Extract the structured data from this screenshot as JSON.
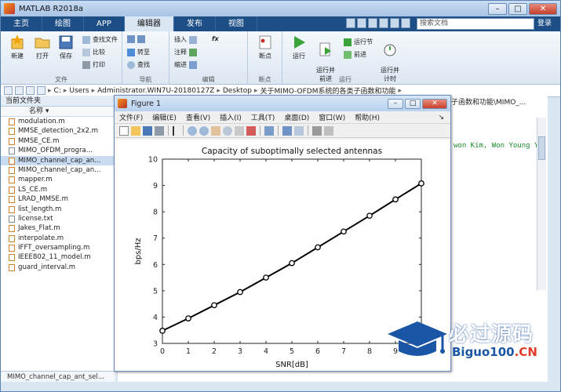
{
  "window": {
    "title": "MATLAB R2018a"
  },
  "tabs": [
    {
      "label": "主页"
    },
    {
      "label": "绘图"
    },
    {
      "label": "APP"
    },
    {
      "label": "编辑器"
    },
    {
      "label": "发布"
    },
    {
      "label": "视图"
    }
  ],
  "search": {
    "placeholder": "搜索文档"
  },
  "login_label": "登录",
  "toolstrip": {
    "file": {
      "label": "文件",
      "new": "新建",
      "open": "打开",
      "save": "保存",
      "find_files": "查找文件",
      "compare": "比较",
      "print": "打印"
    },
    "navigate": {
      "label": "导航",
      "goto": "转至",
      "find": "查找"
    },
    "edit": {
      "label": "编辑",
      "insert": "插入",
      "comment": "注释",
      "indent": "缩进",
      "fx": "fx"
    },
    "breakpoints": {
      "label": "断点",
      "breakpoint": "断点"
    },
    "run": {
      "label": "运行",
      "run": "运行",
      "run_advance": "运行并\n前进",
      "run_section": "运行节",
      "advance": "前进",
      "run_time": "运行并\n计时"
    }
  },
  "path": [
    "C:",
    "Users",
    "Administrator.WIN7U-20180127Z",
    "Desktop",
    "关于MIMO-OFDM系统的各类子函数和功能"
  ],
  "file_panel": {
    "header": "当前文件夹",
    "column": "名称",
    "files": [
      {
        "name": "modulation.m",
        "type": "m"
      },
      {
        "name": "MMSE_detection_2x2.m",
        "type": "m"
      },
      {
        "name": "MMSE_CE.m",
        "type": "m"
      },
      {
        "name": "MIMO_OFDM_progra...",
        "type": "doc"
      },
      {
        "name": "MIMO_channel_cap_an...",
        "type": "m",
        "selected": true
      },
      {
        "name": "MIMO_channel_cap_an...",
        "type": "m"
      },
      {
        "name": "mapper.m",
        "type": "m"
      },
      {
        "name": "LS_CE.m",
        "type": "m"
      },
      {
        "name": "LRAD_MMSE.m",
        "type": "m"
      },
      {
        "name": "list_length.m",
        "type": "m"
      },
      {
        "name": "license.txt",
        "type": "txt"
      },
      {
        "name": "Jakes_Flat.m",
        "type": "m"
      },
      {
        "name": "interpolate.m",
        "type": "m"
      },
      {
        "name": "IFFT_oversampling.m",
        "type": "m"
      },
      {
        "name": "IEEE802_11_model.m",
        "type": "m"
      },
      {
        "name": "guard_interval.m",
        "type": "m"
      }
    ],
    "detail": "MIMO_channel_cap_ant_sel..."
  },
  "editor": {
    "tab_fragment": "子函数和功能\\MIMO_...",
    "code_fragment": "won Kim, Won Young Y"
  },
  "figure": {
    "title": "Figure 1",
    "menu": [
      "文件(F)",
      "编辑(E)",
      "查看(V)",
      "插入(I)",
      "工具(T)",
      "桌面(D)",
      "窗口(W)",
      "帮助(H)"
    ]
  },
  "chart_data": {
    "type": "line",
    "title": "Capacity of suboptimally selected antennas",
    "xlabel": "SNR[dB]",
    "ylabel": "bps/Hz",
    "xlim": [
      0,
      10
    ],
    "ylim": [
      3,
      10
    ],
    "xticks": [
      0,
      1,
      2,
      3,
      4,
      5,
      6,
      7,
      8,
      9,
      10
    ],
    "yticks": [
      3,
      4,
      5,
      6,
      7,
      8,
      9,
      10
    ],
    "grid": false,
    "series": [
      {
        "x": [
          0,
          1,
          2,
          3,
          4,
          5,
          6,
          7,
          8,
          9,
          10
        ],
        "y": [
          3.48,
          3.95,
          4.45,
          4.95,
          5.5,
          6.05,
          6.65,
          7.25,
          7.85,
          8.47,
          9.08
        ],
        "color": "#000000",
        "marker": "circle"
      }
    ]
  },
  "watermark": {
    "line1": "必过源码",
    "line2a": "Biguo100",
    "line2b": ".CN"
  },
  "colors": {
    "ribbon_tab": "#1d4f86",
    "selection": "#c9dcf1",
    "line": "#000000"
  }
}
